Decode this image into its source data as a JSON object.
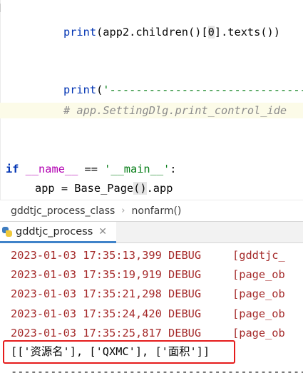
{
  "editor": {
    "line1": {
      "text": "print(app2.children()[0].texts())"
    },
    "line2": {
      "text": "print('-----------------------------------"
    },
    "line3": {
      "text": "# app.SettingDlg.print_control_ide"
    },
    "line4": {
      "text": "if __name__ == '__main__':"
    },
    "line5": {
      "text": "app = Base_Page().app"
    }
  },
  "breadcrumb": {
    "file": "gddtjc_process_class",
    "method": "nonfarm()"
  },
  "run": {
    "tab_label": "gddtjc_process",
    "log_lines": [
      {
        "time": "2023-01-03 17:35:13,399",
        "level": "DEBUG",
        "source": "[gddtjc_"
      },
      {
        "time": "2023-01-03 17:35:19,919",
        "level": "DEBUG",
        "source": "[page_ob"
      },
      {
        "time": "2023-01-03 17:35:21,298",
        "level": "DEBUG",
        "source": "[page_ob"
      },
      {
        "time": "2023-01-03 17:35:24,420",
        "level": "DEBUG",
        "source": "[page_ob"
      },
      {
        "time": "2023-01-03 17:35:25,817",
        "level": "DEBUG",
        "source": "[page_ob"
      }
    ],
    "result": "[['资源名'], ['QXMC'], ['面积']]",
    "separator": "-----------------------------------------------"
  },
  "colors": {
    "log_text": "#a52a2a",
    "highlight_box": "#e51b1b",
    "tab_underline": "#4083c9",
    "comment_line_bg": "#fcfbe8"
  }
}
